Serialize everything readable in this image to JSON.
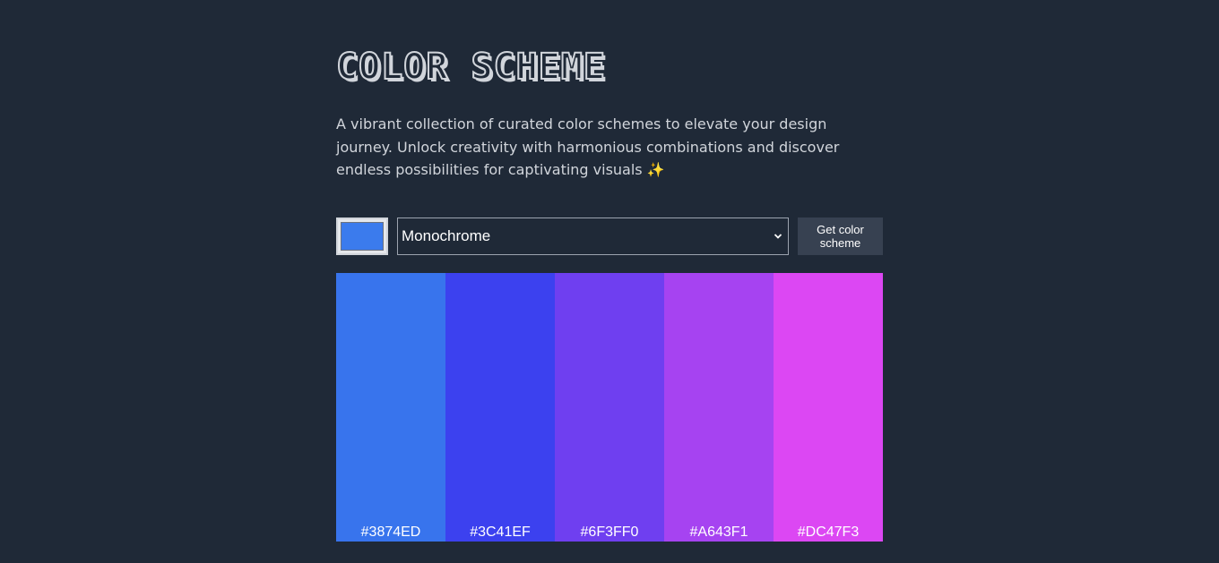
{
  "header": {
    "title": "COLOR SCHEME",
    "description": "A vibrant collection of curated color schemes to elevate your design journey. Unlock creativity with harmonious combinations and discover endless possibilities for captivating visuals ✨"
  },
  "controls": {
    "seed_color": "#3B7BED",
    "mode_selected": "Monochrome",
    "submit_label": "Get color scheme"
  },
  "palette": {
    "colors": [
      {
        "hex": "#3874ED"
      },
      {
        "hex": "#3C41EF"
      },
      {
        "hex": "#6F3FF0"
      },
      {
        "hex": "#A643F1"
      },
      {
        "hex": "#DC47F3"
      }
    ]
  }
}
